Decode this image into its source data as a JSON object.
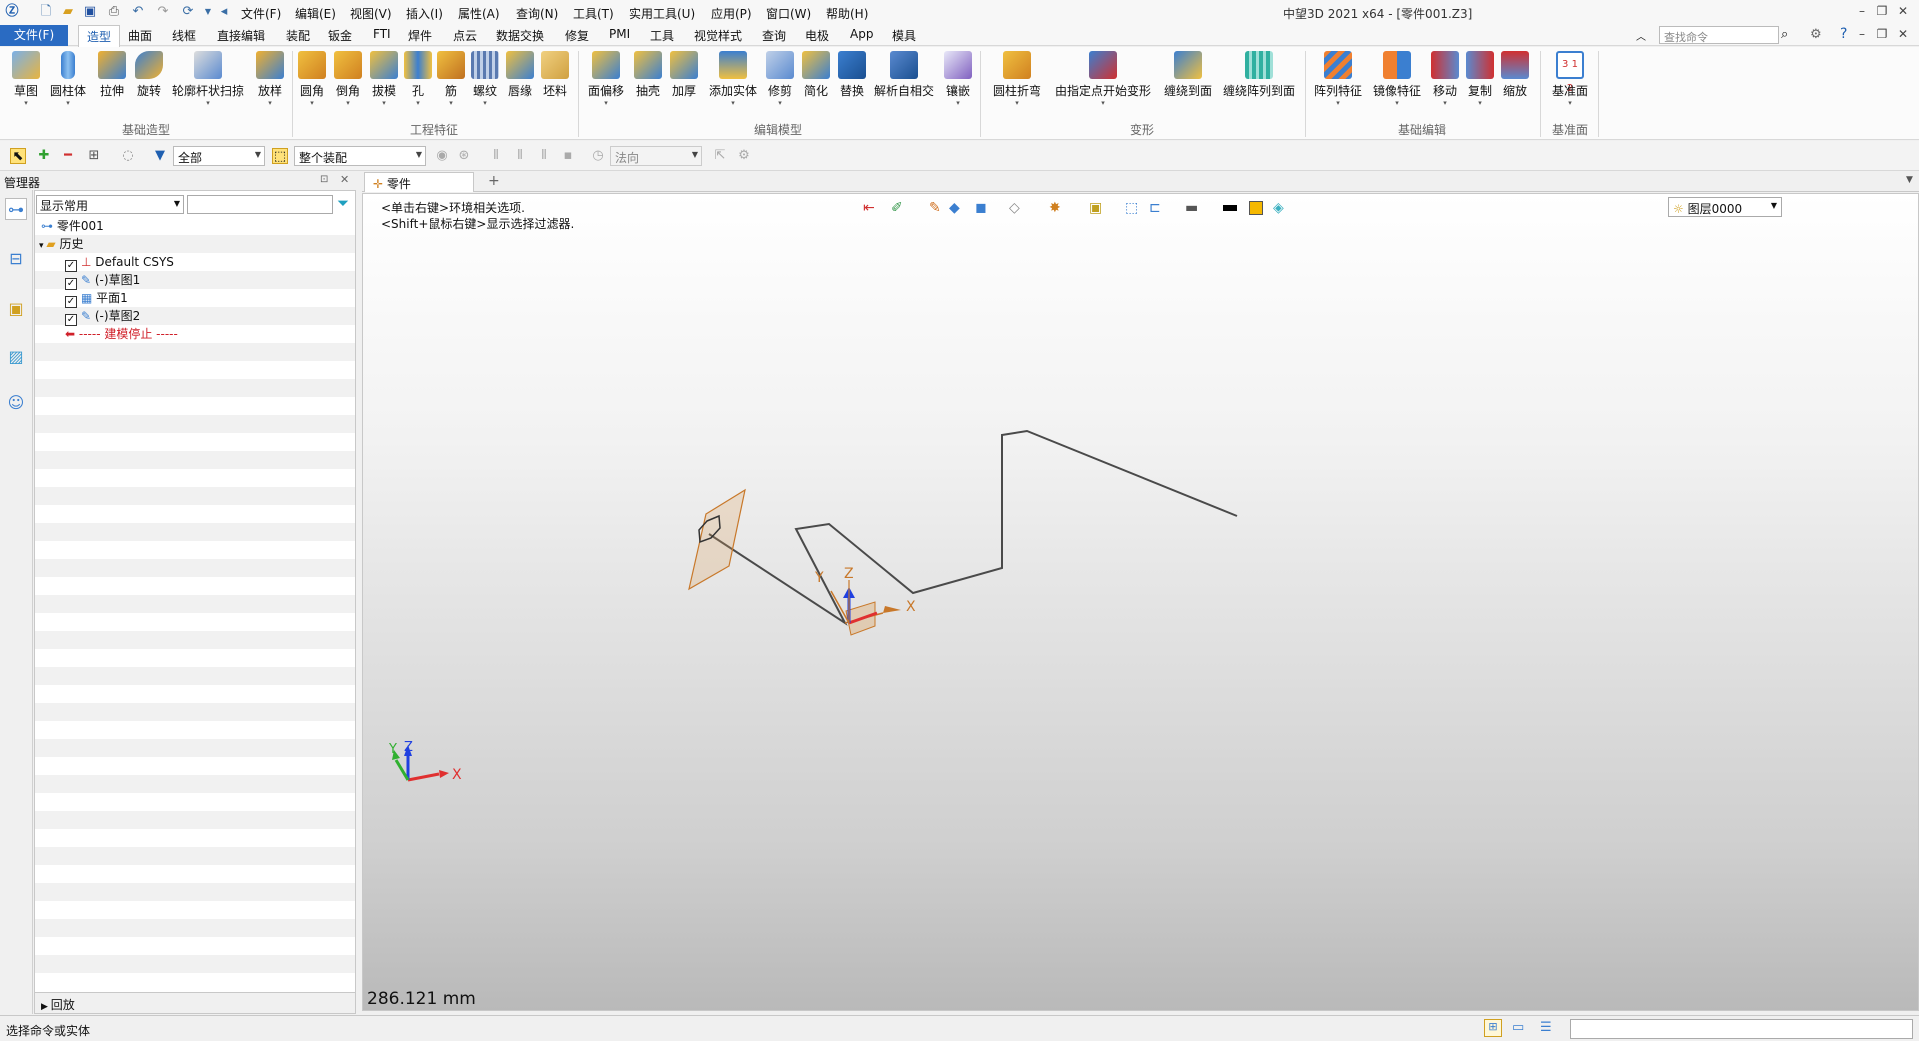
{
  "titlebar": {
    "app_title": "中望3D 2021 x64 - [零件001.Z3]",
    "menus": [
      "文件(F)",
      "编辑(E)",
      "视图(V)",
      "插入(I)",
      "属性(A)",
      "查询(N)",
      "工具(T)",
      "实用工具(U)",
      "应用(P)",
      "窗口(W)",
      "帮助(H)"
    ]
  },
  "ribbon": {
    "file_tab": "文件(F)",
    "tabs": [
      "造型",
      "曲面",
      "线框",
      "直接编辑",
      "装配",
      "钣金",
      "FTI",
      "焊件",
      "点云",
      "数据交换",
      "修复",
      "PMI",
      "工具",
      "视觉样式",
      "查询",
      "电极",
      "App",
      "模具"
    ],
    "active_tab": "造型",
    "search_placeholder": "查找命令",
    "groups": [
      {
        "label": "基础造型",
        "tools": [
          "草图",
          "圆柱体",
          "拉伸",
          "旋转",
          "轮廓杆状扫掠",
          "放样"
        ]
      },
      {
        "label": "工程特征",
        "tools": [
          "圆角",
          "倒角",
          "拔模",
          "孔",
          "筋",
          "螺纹",
          "唇缘",
          "坯料"
        ]
      },
      {
        "label": "编辑模型",
        "tools": [
          "面偏移",
          "抽壳",
          "加厚",
          "添加实体",
          "修剪",
          "简化",
          "替换",
          "解析自相交",
          "镶嵌"
        ]
      },
      {
        "label": "变形",
        "tools": [
          "圆柱折弯",
          "由指定点开始变形",
          "缠绕到面",
          "缠绕阵列到面"
        ]
      },
      {
        "label": "基础编辑",
        "tools": [
          "阵列特征",
          "镜像特征",
          "移动",
          "复制",
          "缩放"
        ]
      },
      {
        "label": "基准面",
        "tools": [
          "基准面"
        ]
      }
    ]
  },
  "toolbar2": {
    "filter_value": "全部",
    "assembly_value": "整个装配",
    "direction_value": "法向"
  },
  "manager": {
    "title": "管理器",
    "display_select": "显示常用",
    "tree": {
      "root": "零件001",
      "history_label": "历史",
      "items": [
        "Default CSYS",
        "(-)草图1",
        "平面1",
        "(-)草图2"
      ],
      "stop_label": "----- 建模停止 -----"
    },
    "footer": "回放"
  },
  "document": {
    "tab_label": "零件001.Z3",
    "hint_line1": "<单击右键>环境相关选项.",
    "hint_line2": "<Shift+鼠标右键>显示选择过滤器.",
    "layer": "图层0000",
    "measure": "286.121 mm",
    "axes": {
      "x": "X",
      "y": "Y",
      "z": "Z"
    }
  },
  "status": {
    "text": "选择命令或实体"
  },
  "colors": {
    "accent": "#2a6bc2",
    "stop_red": "#d0202a",
    "axis_x": "#e03030",
    "axis_y": "#30b030",
    "axis_z": "#2040e0",
    "plane_orange": "#c8782a"
  }
}
